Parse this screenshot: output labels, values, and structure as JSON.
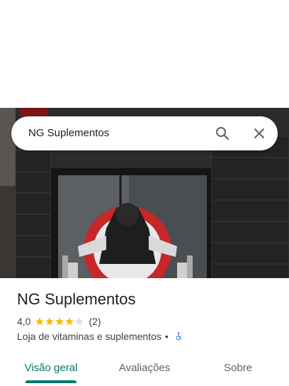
{
  "search": {
    "query": "NG Suplementos"
  },
  "icons": {
    "search": "search-icon",
    "close": "close-icon",
    "accessibility": "wheelchair-accessible-icon"
  },
  "place": {
    "name": "NG Suplementos",
    "rating": "4,0",
    "stars": 4,
    "stars_max": 5,
    "review_count": "(2)",
    "category": "Loja de vitaminas e suplementos",
    "separator": "•"
  },
  "tabs": [
    {
      "label": "Visão geral",
      "active": true
    },
    {
      "label": "Avaliações",
      "active": false
    },
    {
      "label": "Sobre",
      "active": false
    }
  ],
  "colors": {
    "accent": "#00796b",
    "star": "#fbbc04",
    "star_empty": "#dadce0",
    "access": "#1a73e8"
  }
}
